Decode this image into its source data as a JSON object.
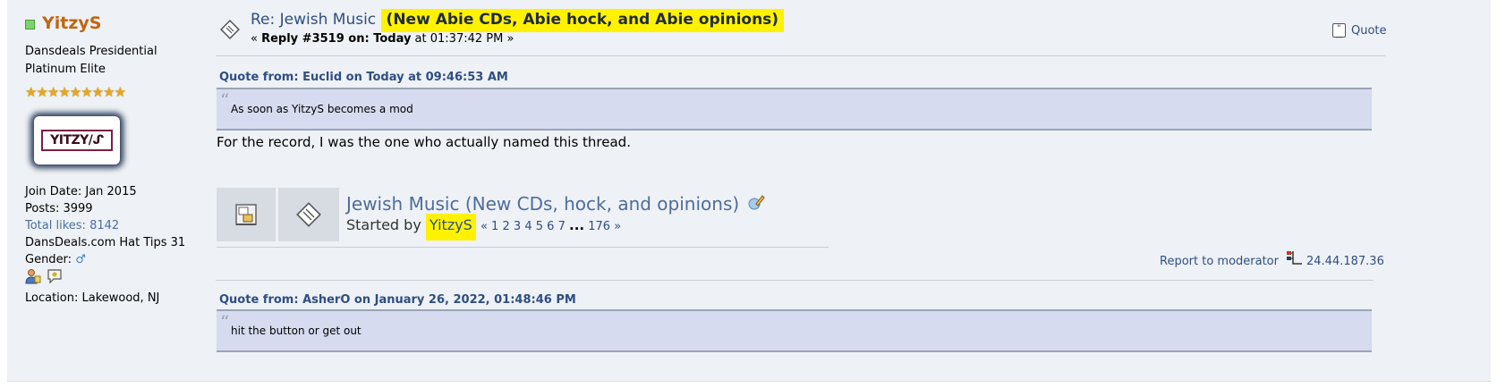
{
  "poster": {
    "username": "YitzyS",
    "membergroup_line1": "Dansdeals Presidential",
    "membergroup_line2": "Platinum Elite",
    "stars": "★★★★★★★★★",
    "avatar_text": "YITZY/ᔑ",
    "join_date": "Join Date: Jan 2015",
    "posts": "Posts: 3999",
    "total_likes": "Total likes: 8142",
    "hat_tips": "DansDeals.com Hat Tips 31",
    "gender_label": "Gender:",
    "gender_icon": "♂",
    "location": "Location: Lakewood, NJ"
  },
  "header": {
    "subject_prefix": "Re: Jewish Music ",
    "subject_highlight": "(New Abie CDs, Abie hock, and Abie opinions)",
    "reply_open": "« ",
    "reply_label": "Reply #3519 on: Today",
    "reply_time": " at 01:37:42 PM »",
    "quote_button": "Quote"
  },
  "quote1": {
    "header": "Quote from: Euclid on Today at 09:46:53 AM",
    "text": "As soon as YitzyS becomes a mod"
  },
  "body_text": "For the record, I was the one who actually named this thread.",
  "topic_card": {
    "title": "Jewish Music (New CDs, hock, and opinions)",
    "started_by": "Started by ",
    "starter": "YitzyS",
    "pages_prefix": "«",
    "pages": [
      "1",
      "2",
      "3",
      "4",
      "5",
      "6",
      "7"
    ],
    "ellipsis": "...",
    "last_page": "176",
    "pages_suffix": "»"
  },
  "moderation": {
    "report": "Report to moderator",
    "ip": "24.44.187.36"
  },
  "quote2": {
    "header": "Quote from: AsherO on January 26, 2022, 01:48:46 PM",
    "text": "hit the button or get out"
  },
  "colors": {
    "username": "#c06510",
    "link": "#2f4e80",
    "highlight": "#fff200",
    "quote_bg": "#d6dbef"
  }
}
